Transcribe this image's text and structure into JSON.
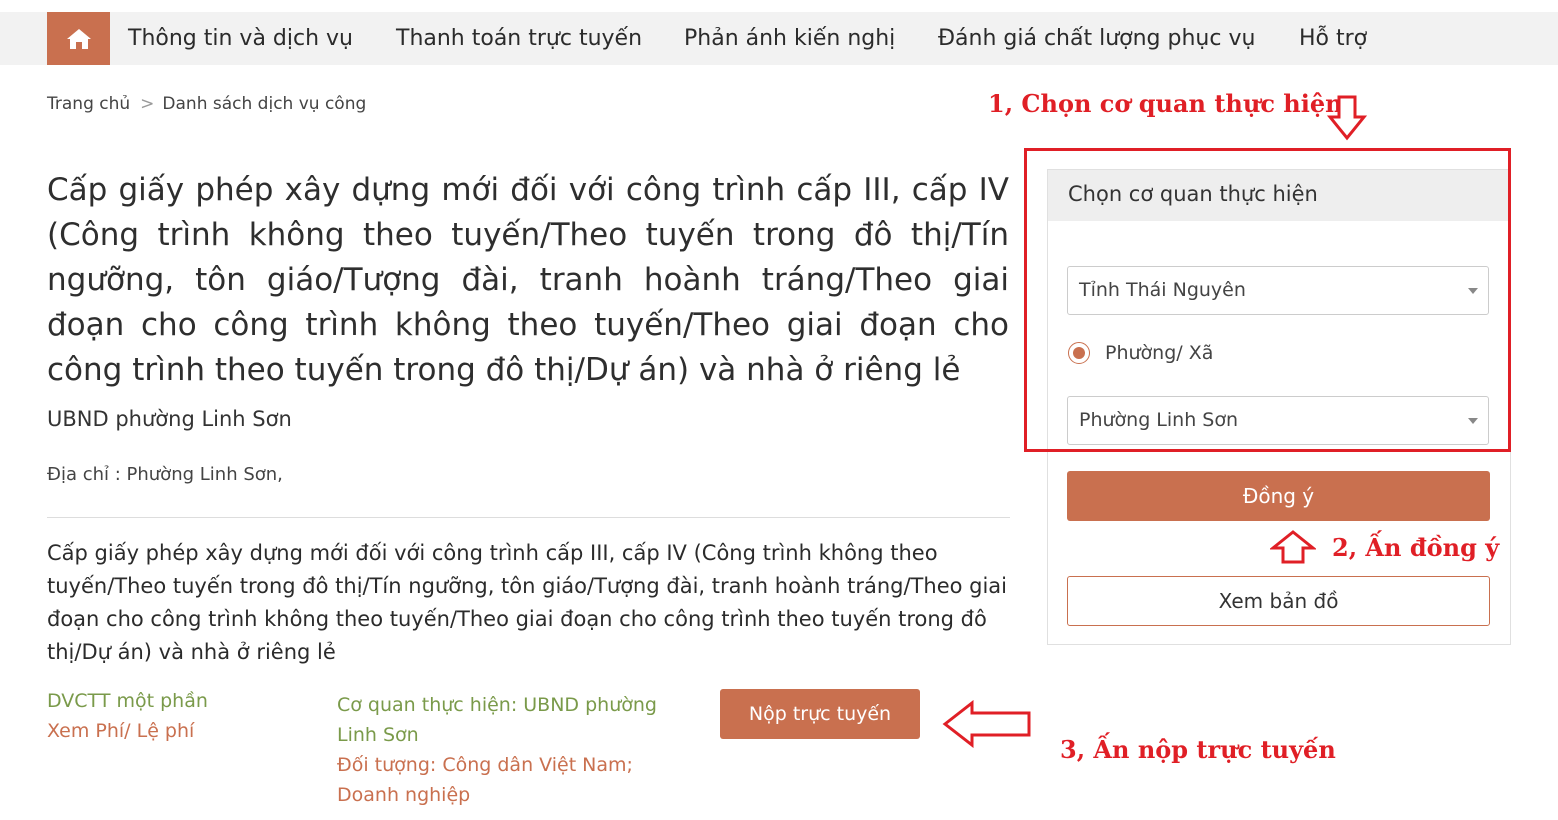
{
  "nav": {
    "items": [
      {
        "label": "Thông tin và dịch vụ"
      },
      {
        "label": "Thanh toán trực tuyến"
      },
      {
        "label": "Phản ánh kiến nghị"
      },
      {
        "label": "Đánh giá chất lượng phục vụ"
      },
      {
        "label": "Hỗ trợ"
      }
    ]
  },
  "breadcrumb": {
    "home": "Trang chủ",
    "separator": ">",
    "current": "Danh sách dịch vụ công"
  },
  "service": {
    "title": "Cấp giấy phép xây dựng mới đối với công trình cấp III, cấp IV (Công trình không theo tuyến/Theo tuyến trong đô thị/Tín ngưỡng, tôn giáo/Tượng đài, tranh hoành tráng/Theo giai đoạn cho công trình không theo tuyến/Theo giai đoạn cho công trình theo tuyến trong đô thị/Dự án) và nhà ở riêng lẻ",
    "agency": "UBND phường Linh Sơn",
    "address": "Địa chỉ : Phường Linh Sơn,",
    "description": "Cấp giấy phép xây dựng mới đối với công trình cấp III, cấp IV (Công trình không theo tuyến/Theo tuyến trong đô thị/Tín ngưỡng, tôn giáo/Tượng đài, tranh hoành tráng/Theo giai đoạn cho công trình không theo tuyến/Theo giai đoạn cho công trình theo tuyến trong đô thị/Dự án) và nhà ở riêng lẻ",
    "level": "DVCTT một phần",
    "fee_link": "Xem Phí/ Lệ phí",
    "executing_agency": "Cơ quan thực hiện: UBND phường Linh Sơn",
    "target": "Đối tượng: Công dân Việt Nam; Doanh nghiệp",
    "submit_label": "Nộp trực tuyến"
  },
  "panel": {
    "heading": "Chọn cơ quan thực hiện",
    "province": "Tỉnh Thái Nguyên",
    "radio_label": "Phường/ Xã",
    "ward": "Phường Linh Sơn",
    "agree_label": "Đồng ý",
    "map_label": "Xem bản đồ"
  },
  "annotations": {
    "step1": "1, Chọn cơ quan thực hiện",
    "step2": "2, Ấn đồng ý",
    "step3": "3, Ấn nộp trực tuyến"
  },
  "colors": {
    "accent": "#c9704f",
    "annotation": "#e01f26",
    "green": "#7a9a4a"
  }
}
